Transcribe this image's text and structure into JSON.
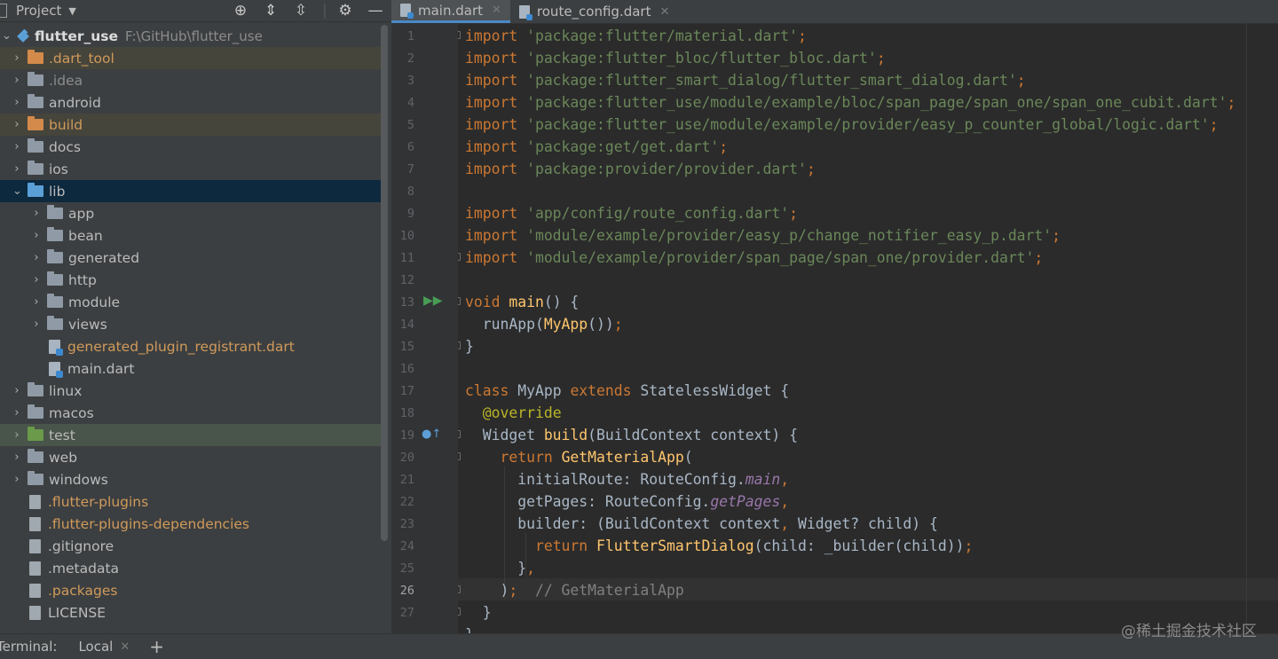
{
  "project_panel": {
    "title": "Project",
    "root": {
      "name": "flutter_use",
      "path": "F:\\GitHub\\flutter_use"
    },
    "items": [
      {
        "label": ".dart_tool",
        "type": "folder"
      },
      {
        "label": ".idea",
        "type": "folder"
      },
      {
        "label": "android",
        "type": "folder"
      },
      {
        "label": "build",
        "type": "folder"
      },
      {
        "label": "docs",
        "type": "folder"
      },
      {
        "label": "ios",
        "type": "folder"
      },
      {
        "label": "lib",
        "type": "folder"
      },
      {
        "label": "app",
        "type": "folder"
      },
      {
        "label": "bean",
        "type": "folder"
      },
      {
        "label": "generated",
        "type": "folder"
      },
      {
        "label": "http",
        "type": "folder"
      },
      {
        "label": "module",
        "type": "folder"
      },
      {
        "label": "views",
        "type": "folder"
      },
      {
        "label": "generated_plugin_registrant.dart",
        "type": "file"
      },
      {
        "label": "main.dart",
        "type": "file"
      },
      {
        "label": "linux",
        "type": "folder"
      },
      {
        "label": "macos",
        "type": "folder"
      },
      {
        "label": "test",
        "type": "folder"
      },
      {
        "label": "web",
        "type": "folder"
      },
      {
        "label": "windows",
        "type": "folder"
      },
      {
        "label": ".flutter-plugins",
        "type": "file"
      },
      {
        "label": ".flutter-plugins-dependencies",
        "type": "file"
      },
      {
        "label": ".gitignore",
        "type": "file"
      },
      {
        "label": ".metadata",
        "type": "file"
      },
      {
        "label": ".packages",
        "type": "file"
      },
      {
        "label": "LICENSE",
        "type": "file"
      }
    ]
  },
  "editor_tabs": [
    {
      "label": "main.dart",
      "active": true
    },
    {
      "label": "route_config.dart",
      "active": false
    }
  ],
  "code": {
    "line_numbers": [
      "1",
      "2",
      "3",
      "4",
      "5",
      "6",
      "7",
      "8",
      "9",
      "10",
      "11",
      "12",
      "13",
      "14",
      "15",
      "16",
      "17",
      "18",
      "19",
      "20",
      "21",
      "22",
      "23",
      "24",
      "25",
      "26",
      "27"
    ],
    "current_line": "26",
    "imports": [
      "'package:flutter/material.dart'",
      "'package:flutter_bloc/flutter_bloc.dart'",
      "'package:flutter_smart_dialog/flutter_smart_dialog.dart'",
      "'package:flutter_use/module/example/bloc/span_page/span_one/span_one_cubit.dart'",
      "'package:flutter_use/module/example/provider/easy_p_counter_global/logic.dart'",
      "'package:get/get.dart'",
      "'package:provider/provider.dart'",
      "'app/config/route_config.dart'",
      "'module/example/provider/easy_p/change_notifier_easy_p.dart'",
      "'module/example/provider/span_page/span_one/provider.dart'"
    ],
    "comment": "// GetMaterialApp"
  },
  "bottom_bar": {
    "label": "Terminal:",
    "tab": "Local"
  },
  "watermark": "@稀土掘金技术社区",
  "colors": {
    "keyword": "#cc7832",
    "string": "#6a8759",
    "function": "#ffc66d",
    "annotation": "#bbb529",
    "field": "#9876aa",
    "plain": "#a9b7c6",
    "comment": "#808080"
  }
}
